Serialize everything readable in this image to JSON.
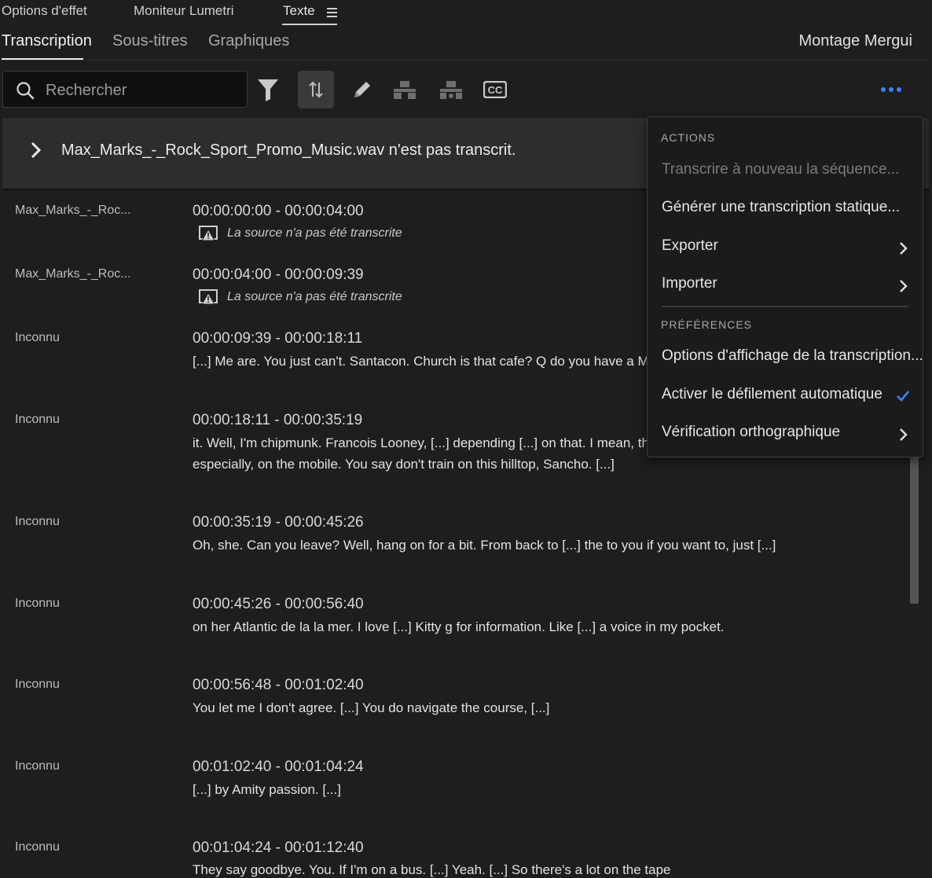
{
  "panel_tabs": [
    {
      "label": "Options d'effet"
    },
    {
      "label": "Moniteur Lumetri"
    },
    {
      "label": "Texte"
    }
  ],
  "sub_tabs": [
    {
      "label": "Transcription"
    },
    {
      "label": "Sous-titres"
    },
    {
      "label": "Graphiques"
    }
  ],
  "sequence_name": "Montage Mergui",
  "search": {
    "placeholder": "Rechercher"
  },
  "toolbar_icons": [
    "filter-icon",
    "split-icon",
    "pencil-icon",
    "merge-icon",
    "align-icon",
    "cc-icon",
    "more-icon"
  ],
  "banner": {
    "text": "Max_Marks_-_Rock_Sport_Promo_Music.wav n'est pas transcrit."
  },
  "transcript": {
    "not_transcribed_note": "La source n'a pas été transcrite",
    "rows": [
      {
        "speaker": "Max_Marks_-_Roc...",
        "time": "00:00:00:00 - 00:00:04:00"
      },
      {
        "speaker": "Max_Marks_-_Roc...",
        "time": "00:00:04:00 - 00:00:09:39"
      },
      {
        "speaker": "Inconnu",
        "time": "00:00:09:39 - 00:00:18:11",
        "text": "[...] Me are. You just can't. Santacon. Church is that cafe? Q do you have a Martiniq"
      },
      {
        "speaker": "Inconnu",
        "time": "00:00:18:11 - 00:00:35:19",
        "text1": "it. Well, I'm chipmunk. Francois Looney, [...] depending [...] on that. I mean, they do",
        "text2": "especially, on the mobile. You say don't train on this hilltop, Sancho. [...]"
      },
      {
        "speaker": "Inconnu",
        "time": "00:00:35:19 - 00:00:45:26",
        "text": "Oh, she. Can you leave? Well, hang on for a bit. From back to [...] the to you if you want to, just [...]"
      },
      {
        "speaker": "Inconnu",
        "time": "00:00:45:26 - 00:00:56:40",
        "text": "on her Atlantic de la la mer. I love [...] Kitty g for information. Like [...] a voice in my pocket."
      },
      {
        "speaker": "Inconnu",
        "time": "00:00:56:48 - 00:01:02:40",
        "text": "You let me I don't agree. [...] You do navigate the course, [...]"
      },
      {
        "speaker": "Inconnu",
        "time": "00:01:02:40 - 00:01:04:24",
        "text": "[...] by Amity passion. [...]"
      },
      {
        "speaker": "Inconnu",
        "time": "00:01:04:24 - 00:01:12:40",
        "text": "They say goodbye. You. If I'm on a bus. [...] Yeah. [...] So there's a lot on the tape"
      }
    ]
  },
  "menu": {
    "actions_header": "ACTIONS",
    "retranscribe": "Transcrire à nouveau la séquence...",
    "static": "Générer une transcription statique...",
    "export": "Exporter",
    "import": "Importer",
    "prefs_header": "PRÉFÉRENCES",
    "display_options": "Options d'affichage de la transcription...",
    "autoscroll": "Activer le défilement automatique",
    "spellcheck": "Vérification orthographique"
  },
  "colors": {
    "accent": "#3b7ddd",
    "underline": "#c0392b",
    "more_icon": "#3b82f6"
  }
}
